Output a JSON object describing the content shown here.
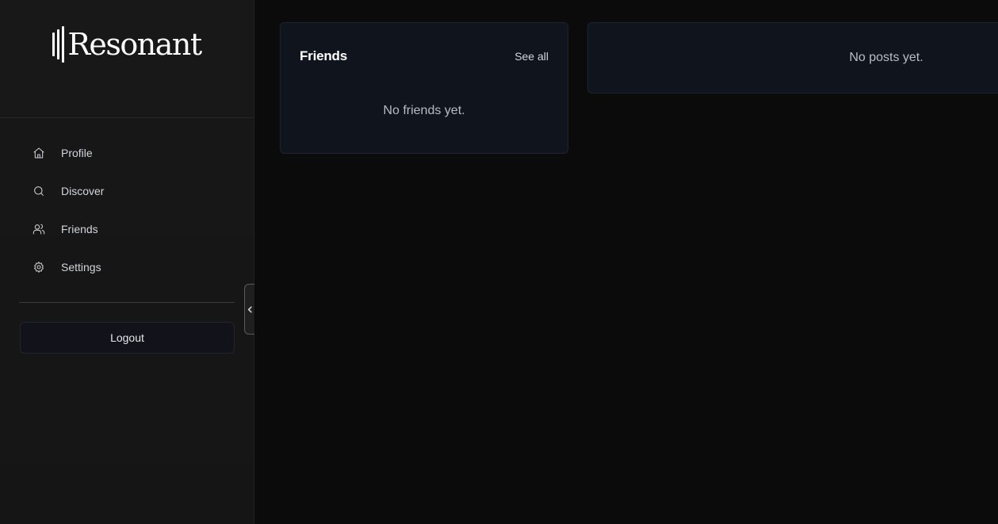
{
  "brand": {
    "name": "Resonant"
  },
  "sidebar": {
    "items": [
      {
        "label": "Profile",
        "icon": "home-icon"
      },
      {
        "label": "Discover",
        "icon": "search-icon"
      },
      {
        "label": "Friends",
        "icon": "users-icon"
      },
      {
        "label": "Settings",
        "icon": "gear-icon"
      }
    ],
    "logout_label": "Logout",
    "collapse_icon": "chevron-left-icon"
  },
  "friends_card": {
    "title": "Friends",
    "see_all_label": "See all",
    "empty_text": "No friends yet."
  },
  "posts_card": {
    "empty_text": "No posts yet."
  }
}
